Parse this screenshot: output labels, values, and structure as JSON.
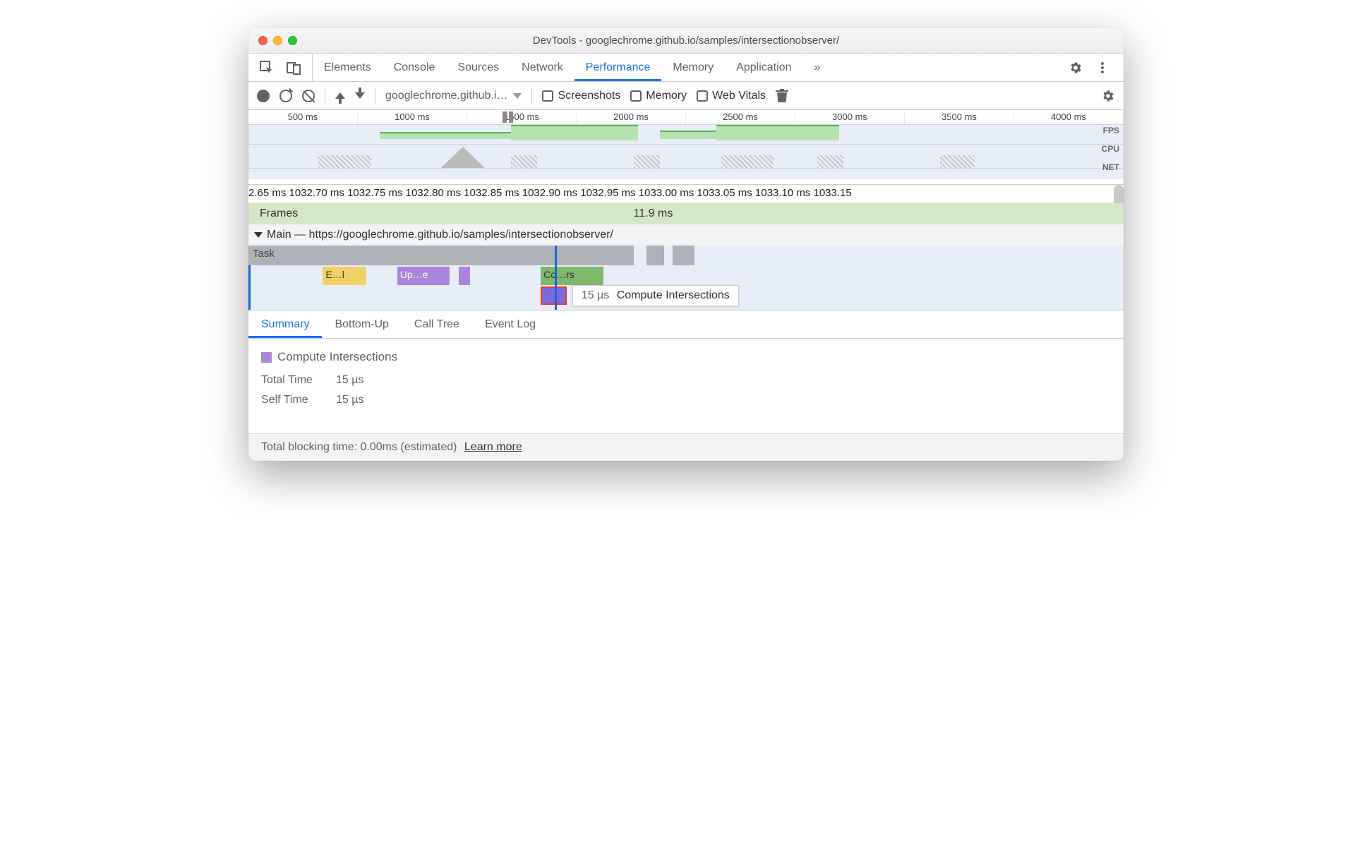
{
  "window": {
    "title": "DevTools - googlechrome.github.io/samples/intersectionobserver/"
  },
  "tabs": {
    "items": [
      "Elements",
      "Console",
      "Sources",
      "Network",
      "Performance",
      "Memory",
      "Application"
    ],
    "active": "Performance",
    "overflow": "»"
  },
  "toolbar": {
    "dropdown": "googlechrome.github.i…",
    "screenshots": "Screenshots",
    "memory": "Memory",
    "webvitals": "Web Vitals"
  },
  "overview": {
    "ticks": [
      "500 ms",
      "1000 ms",
      "1500 ms",
      "2000 ms",
      "2500 ms",
      "3000 ms",
      "3500 ms",
      "4000 ms"
    ],
    "labels": {
      "fps": "FPS",
      "cpu": "CPU",
      "net": "NET"
    }
  },
  "detail": {
    "ruler": "2.65 ms 1032.70 ms 1032.75 ms 1032.80 ms 1032.85 ms 1032.90 ms 1032.95 ms 1033.00 ms 1033.05 ms 1033.10 ms 1033.15",
    "frames_label": "Frames",
    "frames_value": "11.9 ms",
    "main_label": "Main — https://googlechrome.github.io/samples/intersectionobserver/",
    "task_label": "Task",
    "events": {
      "yellow": "E…l",
      "purple": "Up…e",
      "green": "Co…rs"
    },
    "tooltip": {
      "time": "15 µs",
      "name": "Compute Intersections"
    }
  },
  "bottom_tabs": {
    "items": [
      "Summary",
      "Bottom-Up",
      "Call Tree",
      "Event Log"
    ],
    "active": "Summary"
  },
  "summary": {
    "name": "Compute Intersections",
    "rows": [
      {
        "label": "Total Time",
        "value": "15 µs"
      },
      {
        "label": "Self Time",
        "value": "15 µs"
      }
    ]
  },
  "footer": {
    "text": "Total blocking time: 0.00ms (estimated)",
    "link": "Learn more"
  }
}
